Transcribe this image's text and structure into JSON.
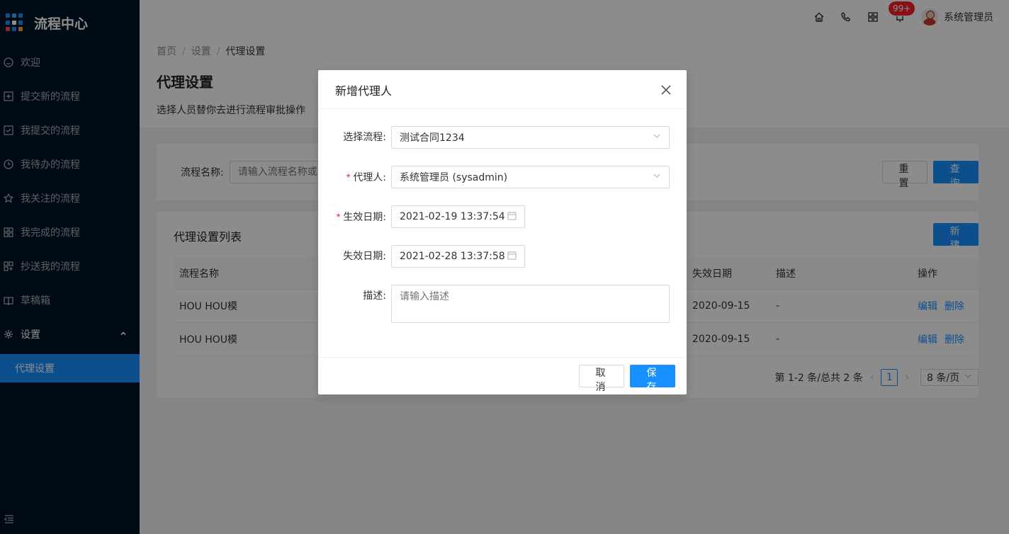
{
  "app": {
    "title": "流程中心"
  },
  "sidebar": {
    "items": [
      {
        "label": "欢迎",
        "icon": "smile-icon"
      },
      {
        "label": "提交新的流程",
        "icon": "plus-square-icon"
      },
      {
        "label": "我提交的流程",
        "icon": "check-square-icon"
      },
      {
        "label": "我待办的流程",
        "icon": "clock-icon"
      },
      {
        "label": "我关注的流程",
        "icon": "star-icon"
      },
      {
        "label": "我完成的流程",
        "icon": "appstore-icon"
      },
      {
        "label": "抄送我的流程",
        "icon": "copy-icon"
      },
      {
        "label": "草稿箱",
        "icon": "book-icon"
      }
    ],
    "settings": {
      "label": "设置",
      "icon": "gear-icon",
      "sub": "代理设置"
    }
  },
  "header": {
    "badge": "99+",
    "username": "系统管理员"
  },
  "page": {
    "breadcrumb": [
      "首页",
      "设置",
      "代理设置"
    ],
    "title": "代理设置",
    "description": "选择人员替你去进行流程审批操作"
  },
  "search": {
    "label": "流程名称:",
    "placeholder": "请输入流程名称或",
    "reset": "重置",
    "query": "查询"
  },
  "list": {
    "title": "代理设置列表",
    "new_button": "新建",
    "columns": [
      "流程名称",
      "失效日期",
      "描述",
      "操作"
    ],
    "rows": [
      {
        "name": "HOU HOU模",
        "expire": "2020-09-15",
        "desc": "-",
        "edit": "编辑",
        "delete": "删除"
      },
      {
        "name": "HOU HOU模",
        "expire": "2020-09-15",
        "desc": "-",
        "edit": "编辑",
        "delete": "删除"
      }
    ],
    "pagination": {
      "summary": "第 1-2 条/总共 2 条",
      "current": "1",
      "page_size": "8 条/页"
    }
  },
  "modal": {
    "title": "新增代理人",
    "fields": {
      "process": {
        "label": "选择流程:",
        "value": "测试合同1234"
      },
      "agent": {
        "label": "代理人:",
        "value": "系统管理员 (sysadmin)",
        "required": "*"
      },
      "start": {
        "label": "生效日期:",
        "value": "2021-02-19 13:37:54",
        "required": "*"
      },
      "end": {
        "label": "失效日期:",
        "value": "2021-02-28 13:37:58"
      },
      "desc": {
        "label": "描述:",
        "placeholder": "请输入描述"
      }
    },
    "cancel": "取 消",
    "save": "保 存"
  },
  "colors": {
    "primary": "#1890ff",
    "sidebar_bg": "#001529",
    "danger": "#f5222d"
  }
}
